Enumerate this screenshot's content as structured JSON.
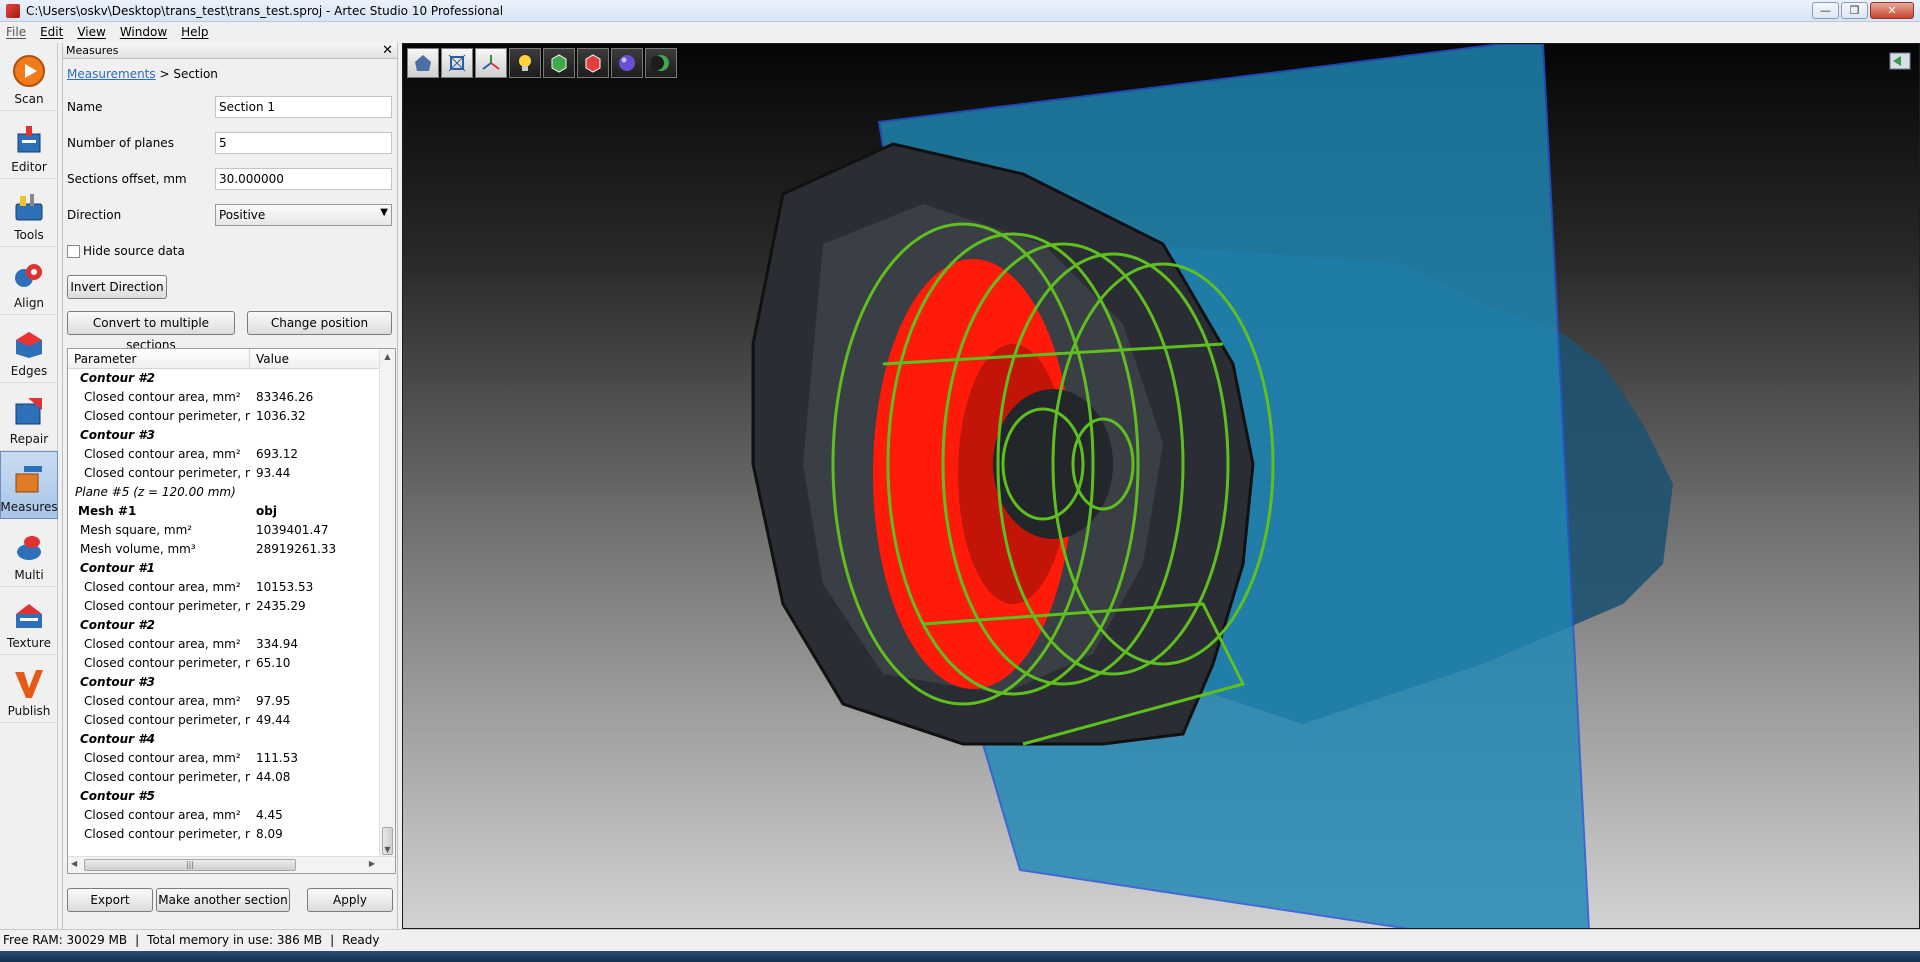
{
  "window": {
    "title": "C:\\Users\\oskv\\Desktop\\trans_test\\trans_test.sproj - Artec Studio 10 Professional"
  },
  "menu": [
    "File",
    "Edit",
    "View",
    "Window",
    "Help"
  ],
  "tools": [
    {
      "label": "Scan",
      "icon": "scan-icon"
    },
    {
      "label": "Editor",
      "icon": "editor-icon"
    },
    {
      "label": "Tools",
      "icon": "tools-icon"
    },
    {
      "label": "Align",
      "icon": "align-icon"
    },
    {
      "label": "Edges",
      "icon": "edges-icon"
    },
    {
      "label": "Repair",
      "icon": "repair-icon"
    },
    {
      "label": "Measures",
      "icon": "measures-icon",
      "active": true
    },
    {
      "label": "Multi",
      "icon": "multi-icon"
    },
    {
      "label": "Texture",
      "icon": "texture-icon"
    },
    {
      "label": "Publish",
      "icon": "publish-icon"
    }
  ],
  "panel": {
    "title": "Measures",
    "breadcrumb_link": "Measurements",
    "breadcrumb_sep": " > ",
    "breadcrumb_current": "Section",
    "name_label": "Name",
    "name_value": "Section 1",
    "planes_label": "Number of planes",
    "planes_value": "5",
    "offset_label": "Sections offset, mm",
    "offset_value": "30.000000",
    "direction_label": "Direction",
    "direction_value": "Positive",
    "hide_label": "Hide source data",
    "invert_btn": "Invert Direction",
    "convert_btn": "Convert to multiple sections",
    "change_btn": "Change position",
    "export_btn": "Export",
    "another_btn": "Make another section",
    "apply_btn": "Apply"
  },
  "table": {
    "col_param": "Parameter",
    "col_value": "Value",
    "rows": [
      {
        "type": "contour",
        "p": "Contour #2",
        "v": ""
      },
      {
        "type": "item",
        "p": "Closed contour area, mm²",
        "v": "83346.26"
      },
      {
        "type": "item",
        "p": "Closed contour perimeter, mm",
        "v": "1036.32"
      },
      {
        "type": "contour",
        "p": "Contour #3",
        "v": ""
      },
      {
        "type": "item",
        "p": "Closed contour area, mm²",
        "v": "693.12"
      },
      {
        "type": "item",
        "p": "Closed contour perimeter, mm",
        "v": "93.44"
      },
      {
        "type": "plane",
        "p": "Plane #5 (z = 120.00 mm)",
        "v": ""
      },
      {
        "type": "mesh",
        "p": "Mesh #1",
        "v": "obj"
      },
      {
        "type": "meshitem",
        "p": "Mesh square, mm²",
        "v": "1039401.47"
      },
      {
        "type": "meshitem",
        "p": "Mesh volume, mm³",
        "v": "28919261.33"
      },
      {
        "type": "contour",
        "p": "Contour #1",
        "v": ""
      },
      {
        "type": "item",
        "p": "Closed contour area, mm²",
        "v": "10153.53"
      },
      {
        "type": "item",
        "p": "Closed contour perimeter, mm",
        "v": "2435.29"
      },
      {
        "type": "contour",
        "p": "Contour #2",
        "v": ""
      },
      {
        "type": "item",
        "p": "Closed contour area, mm²",
        "v": "334.94"
      },
      {
        "type": "item",
        "p": "Closed contour perimeter, mm",
        "v": "65.10"
      },
      {
        "type": "contour",
        "p": "Contour #3",
        "v": ""
      },
      {
        "type": "item",
        "p": "Closed contour area, mm²",
        "v": "97.95"
      },
      {
        "type": "item",
        "p": "Closed contour perimeter, mm",
        "v": "49.44"
      },
      {
        "type": "contour",
        "p": "Contour #4",
        "v": ""
      },
      {
        "type": "item",
        "p": "Closed contour area, mm²",
        "v": "111.53"
      },
      {
        "type": "item",
        "p": "Closed contour perimeter, mm",
        "v": "44.08"
      },
      {
        "type": "contour",
        "p": "Contour #5",
        "v": ""
      },
      {
        "type": "item",
        "p": "Closed contour area, mm²",
        "v": "4.45"
      },
      {
        "type": "item",
        "p": "Closed contour perimeter, mm",
        "v": "8.09"
      }
    ]
  },
  "viewport_toolbar": [
    "home-view-icon",
    "fit-view-icon",
    "axes-icon",
    "light-bulb-icon",
    "green-cube-icon",
    "red-cube-icon",
    "sphere-icon",
    "crescent-icon"
  ],
  "status": {
    "ram": "Free RAM: 30029 MB",
    "sep1": "|",
    "memory": "Total memory in use: 386 MB",
    "sep2": "|",
    "state": "Ready"
  },
  "colors": {
    "plane": "#1f87b5",
    "contour": "#5fbf1e",
    "section_fill": "#ff1a0a",
    "accent": "#2c6bc4"
  }
}
